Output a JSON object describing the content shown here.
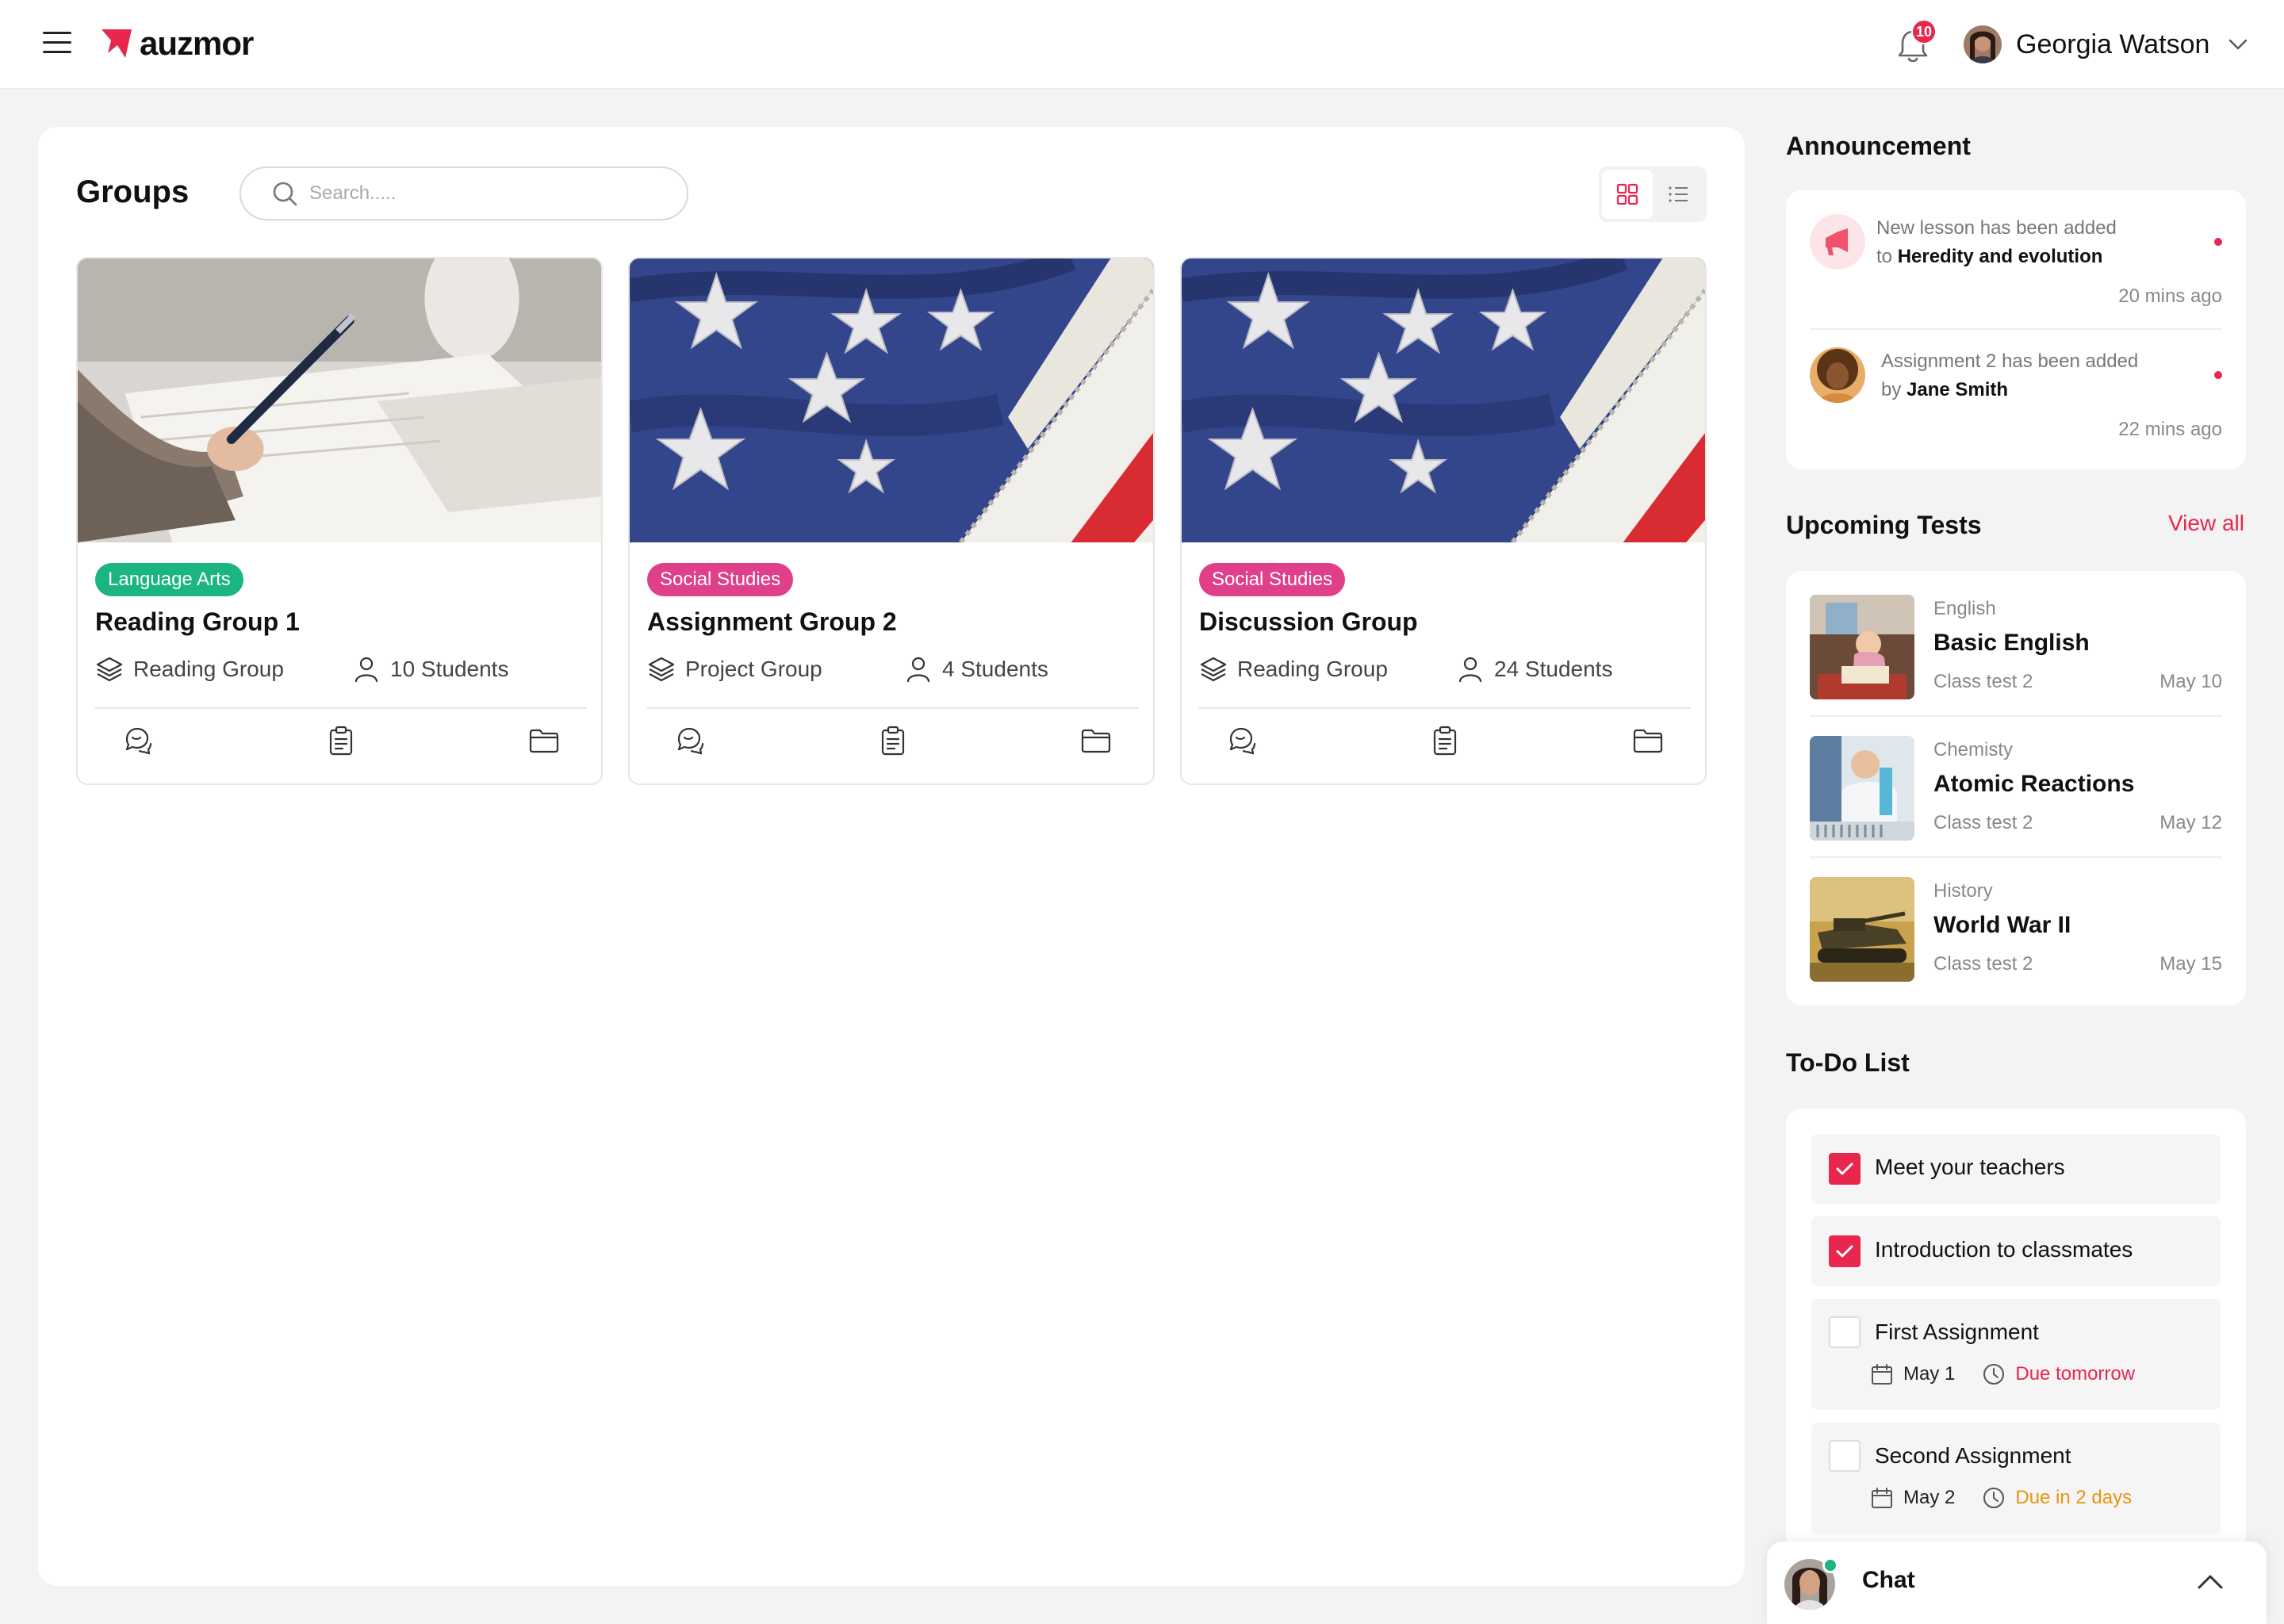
{
  "header": {
    "brand": "auzmor",
    "notifications_count": "10",
    "user_name": "Georgia Watson"
  },
  "groups": {
    "title": "Groups",
    "search_placeholder": "Search.....",
    "cards": [
      {
        "tag": "Language Arts",
        "tag_color": "#1ab581",
        "title": "Reading Group 1",
        "type": "Reading Group",
        "students": "10 Students"
      },
      {
        "tag": "Social Studies",
        "tag_color": "#e0408a",
        "title": "Assignment Group 2",
        "type": "Project Group",
        "students": "4 Students"
      },
      {
        "tag": "Social Studies",
        "tag_color": "#e0408a",
        "title": "Discussion Group",
        "type": "Reading Group",
        "students": "24 Students"
      }
    ]
  },
  "announcement": {
    "title": "Announcement",
    "items": [
      {
        "line1": "New lesson has been added",
        "line2_prefix": "to",
        "line2_bold": "Heredity and evolution",
        "time": "20 mins ago"
      },
      {
        "line1": "Assignment 2 has been added",
        "line2_prefix": "by",
        "line2_bold": "Jane Smith",
        "time": "22 mins ago"
      }
    ]
  },
  "upcoming_tests": {
    "title": "Upcoming Tests",
    "view_all": "View all",
    "items": [
      {
        "subject": "English",
        "name": "Basic English",
        "class": "Class test 2",
        "date": "May 10"
      },
      {
        "subject": "Chemisty",
        "name": "Atomic Reactions",
        "class": "Class test 2",
        "date": "May 12"
      },
      {
        "subject": "History",
        "name": "World War II",
        "class": "Class test 2",
        "date": "May 15"
      }
    ]
  },
  "todo": {
    "title": "To-Do List",
    "items": [
      {
        "label": "Meet your teachers",
        "checked": true
      },
      {
        "label": "Introduction to classmates",
        "checked": true
      },
      {
        "label": "First Assignment",
        "checked": false,
        "date": "May 1",
        "due": "Due tomorrow",
        "due_color": "#e8264e"
      },
      {
        "label": "Second Assignment",
        "checked": false,
        "date": "May 2",
        "due": "Due in 2 days",
        "due_color": "#e8950f"
      }
    ]
  },
  "chat": {
    "title": "Chat"
  },
  "colors": {
    "accent": "#e8264e",
    "green": "#1ab581",
    "pink_tag": "#e0408a",
    "orange": "#e8950f"
  }
}
